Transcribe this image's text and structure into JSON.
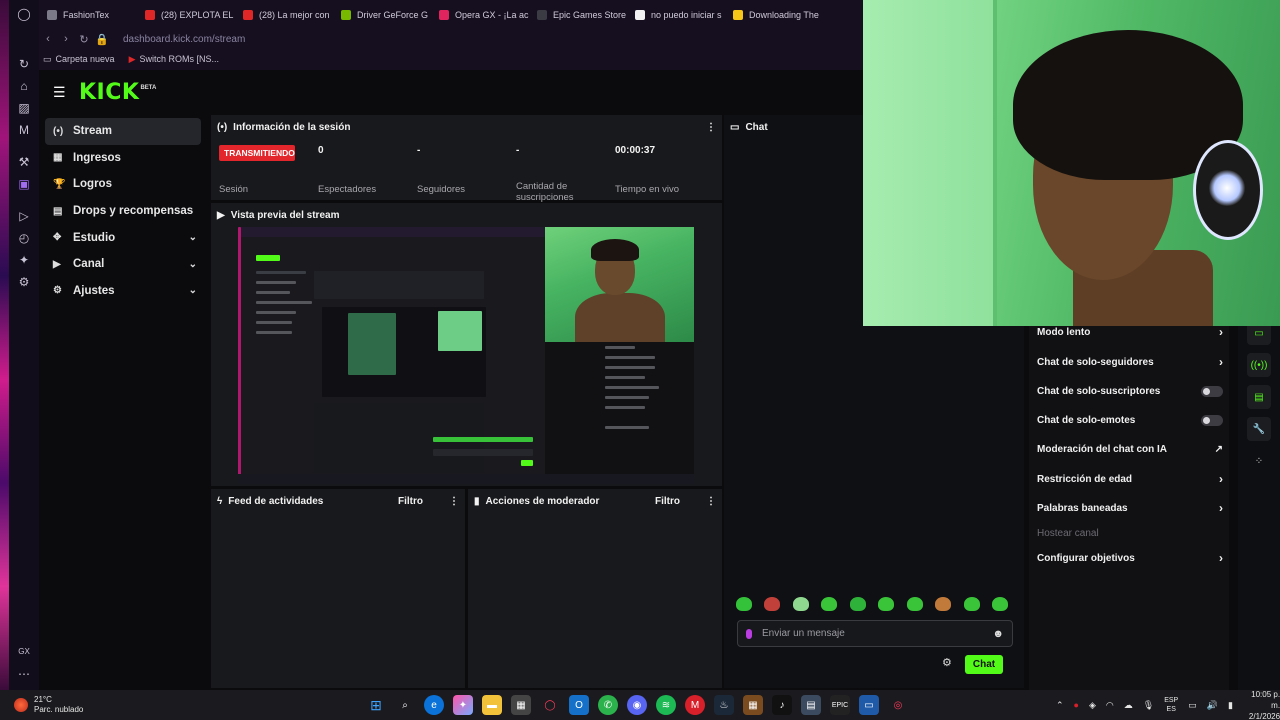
{
  "browser": {
    "tabs": [
      {
        "title": "FashionTex",
        "color": "#7a7a88"
      },
      {
        "title": "(28) EXPLOTA EL",
        "color": "#e02727"
      },
      {
        "title": "(28) La mejor con",
        "color": "#e02727"
      },
      {
        "title": "Driver GeForce G",
        "color": "#76b900"
      },
      {
        "title": "Opera GX - ¡La ac",
        "color": "#e0245e"
      },
      {
        "title": "Epic Games Store",
        "color": "#3b3b44"
      },
      {
        "title": "no puedo iniciar s",
        "color": "#f2f2f2"
      },
      {
        "title": "Downloading The",
        "color": "#f5c518"
      }
    ],
    "url": "dashboard.kick.com/stream",
    "bookmarks": [
      {
        "label": "Carpeta nueva"
      },
      {
        "label": "Switch ROMs [NS..."
      }
    ]
  },
  "kick": {
    "logo": "KICK",
    "logo_beta": "BETA",
    "nav": [
      {
        "label": "Stream",
        "icon": "radio-icon",
        "glyph": "(•)",
        "active": true,
        "chevron": false
      },
      {
        "label": "Ingresos",
        "icon": "chart-icon",
        "glyph": "▦",
        "active": false,
        "chevron": false
      },
      {
        "label": "Logros",
        "icon": "trophy-icon",
        "glyph": "🏆",
        "active": false,
        "chevron": false
      },
      {
        "label": "Drops y recompensas",
        "icon": "gift-icon",
        "glyph": "▤",
        "active": false,
        "chevron": false
      },
      {
        "label": "Estudio",
        "icon": "studio-icon",
        "glyph": "✥",
        "active": false,
        "chevron": true
      },
      {
        "label": "Canal",
        "icon": "channel-icon",
        "glyph": "▶",
        "active": false,
        "chevron": true
      },
      {
        "label": "Ajustes",
        "icon": "gear-icon",
        "glyph": "⚙",
        "active": false,
        "chevron": true
      }
    ],
    "session": {
      "title": "Información de la sesión",
      "status": "TRANSMITIENDO",
      "status_label": "Sesión",
      "stats": [
        {
          "value": "0",
          "label": "Espectadores"
        },
        {
          "value": "-",
          "label": "Seguidores"
        },
        {
          "value": "-",
          "label": "Cantidad de suscripciones"
        },
        {
          "value": "00:00:37",
          "label": "Tiempo en vivo"
        }
      ]
    },
    "preview": {
      "title": "Vista previa del stream"
    },
    "feed": {
      "title": "Feed de actividades",
      "filter": "Filtro"
    },
    "mods": {
      "title": "Acciones de moderador",
      "filter": "Filtro"
    },
    "chat": {
      "title": "Chat",
      "placeholder": "Enviar un mensaje",
      "send": "Chat",
      "emote_count": 10
    },
    "chat_settings": [
      {
        "label": "Modo lento",
        "control": "arrow"
      },
      {
        "label": "Chat de solo-seguidores",
        "control": "arrow"
      },
      {
        "label": "Chat de solo-suscriptores",
        "control": "toggle"
      },
      {
        "label": "Chat de solo-emotes",
        "control": "toggle"
      },
      {
        "label": "Moderación del chat con IA",
        "control": "external"
      },
      {
        "label": "Restricción de edad",
        "control": "arrow"
      },
      {
        "label": "Palabras baneadas",
        "control": "arrow"
      },
      {
        "label": "Hostear canal",
        "control": "none",
        "dim": true
      },
      {
        "label": "Configurar objetivos",
        "control": "arrow"
      }
    ]
  },
  "taskbar": {
    "temp": "21°C",
    "weather": "Parc. nublado",
    "lang_top": "ESP",
    "lang_bottom": "ES",
    "time": "10:05 p. m.",
    "date": "2/1/2026"
  }
}
